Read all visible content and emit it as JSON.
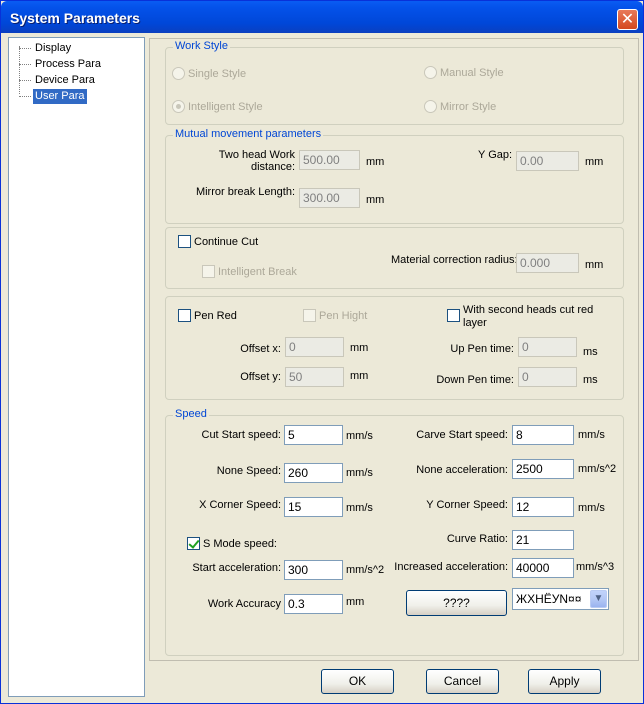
{
  "window": {
    "title": "System Parameters",
    "close_glyph": "✕"
  },
  "tree": {
    "items": [
      {
        "label": "Display"
      },
      {
        "label": "Process Para"
      },
      {
        "label": "Device Para"
      },
      {
        "label": "User Para"
      }
    ],
    "selected": "User Para"
  },
  "work_style": {
    "title": "Work Style",
    "single": "Single Style",
    "manual": "Manual Style",
    "intelligent": "Intelligent Style",
    "mirror": "Mirror Style",
    "selected": "Intelligent Style"
  },
  "mutual": {
    "title": "Mutual movement parameters",
    "two_head_label_1": "Two head Work",
    "two_head_label_2": "distance:",
    "two_head_value": "500.00",
    "two_head_unit": "mm",
    "y_gap_label": "Y Gap:",
    "y_gap_value": "0.00",
    "y_gap_unit": "mm",
    "mirror_label": "Mirror break Length:",
    "mirror_value": "300.00",
    "mirror_unit": "mm"
  },
  "cut": {
    "continue_cut": "Continue Cut",
    "continue_checked": false,
    "intelligent_break": "Intelligent Break",
    "material_label": "Material correction radius:",
    "material_value": "0.000",
    "material_unit": "mm"
  },
  "pen": {
    "pen_red": "Pen Red",
    "pen_hight": "Pen Hight",
    "second_heads_1": "With second heads cut red",
    "second_heads_2": "layer",
    "offset_x_label": "Offset x:",
    "offset_x_value": "0",
    "offset_x_unit": "mm",
    "offset_y_label": "Offset y:",
    "offset_y_value": "50",
    "offset_y_unit": "mm",
    "up_pen_label": "Up Pen time:",
    "up_pen_value": "0",
    "up_pen_unit": "ms",
    "down_pen_label": "Down Pen time:",
    "down_pen_value": "0",
    "down_pen_unit": "ms"
  },
  "speed": {
    "title": "Speed",
    "cut_start_label": "Cut Start speed:",
    "cut_start_value": "5",
    "cut_start_unit": "mm/s",
    "carve_start_label": "Carve Start speed:",
    "carve_start_value": "8",
    "carve_start_unit": "mm/s",
    "none_speed_label": "None Speed:",
    "none_speed_value": "260",
    "none_speed_unit": "mm/s",
    "none_acc_label": "None acceleration:",
    "none_acc_value": "2500",
    "none_acc_unit": "mm/s^2",
    "x_corner_label": "X Corner Speed:",
    "x_corner_value": "15",
    "x_corner_unit": "mm/s",
    "y_corner_label": "Y Corner Speed:",
    "y_corner_value": "12",
    "y_corner_unit": "mm/s",
    "s_mode_label": "S Mode speed:",
    "s_mode_checked": true,
    "curve_ratio_label": "Curve Ratio:",
    "curve_ratio_value": "21",
    "start_acc_label": "Start acceleration:",
    "start_acc_value": "300",
    "start_acc_unit": "mm/s^2",
    "inc_acc_label": "Increased acceleration:",
    "inc_acc_value": "40000",
    "inc_acc_unit": "mm/s^3",
    "work_acc_label": "Work Accuracy",
    "work_acc_value": "0.3",
    "work_acc_unit": "mm",
    "unknown_button": "????",
    "combo_value": "ЖХНЁУN¤¤",
    "combo_arrow_glyph": "▼"
  },
  "buttons": {
    "ok": "OK",
    "cancel": "Cancel",
    "apply": "Apply"
  }
}
